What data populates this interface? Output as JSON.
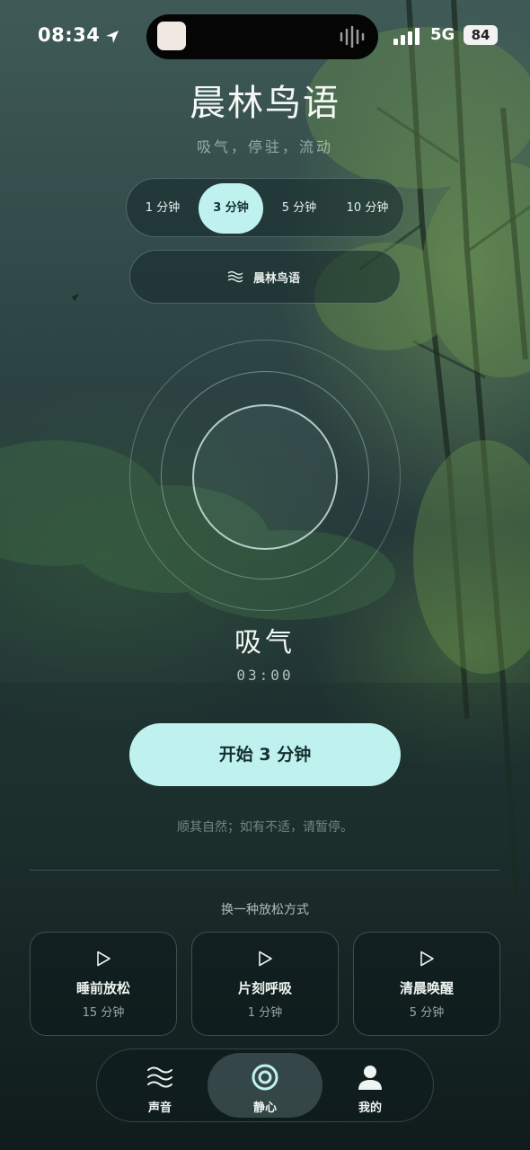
{
  "status_bar": {
    "time": "08:34",
    "network": "5G",
    "battery": "84"
  },
  "header": {
    "title": "晨林鸟语",
    "subtitle": "吸气，停驻，流动"
  },
  "durations": [
    {
      "label": "1 分钟",
      "active": false
    },
    {
      "label": "3 分钟",
      "active": true
    },
    {
      "label": "5 分钟",
      "active": false
    },
    {
      "label": "10 分钟",
      "active": false
    }
  ],
  "sound": {
    "label": "晨林鸟语",
    "icon": "waves-icon"
  },
  "breathing": {
    "phase": "吸气",
    "timer": "03:00"
  },
  "start_button": {
    "label": "开始 3 分钟"
  },
  "notice": "顺其自然；如有不适，请暂停。",
  "alternatives": {
    "title": "换一种放松方式",
    "items": [
      {
        "name": "睡前放松",
        "duration": "15 分钟",
        "icon": "play-icon"
      },
      {
        "name": "片刻呼吸",
        "duration": "1 分钟",
        "icon": "play-icon"
      },
      {
        "name": "清晨唤醒",
        "duration": "5 分钟",
        "icon": "play-icon"
      }
    ]
  },
  "tabbar": {
    "items": [
      {
        "label": "声音",
        "icon": "waves-icon",
        "active": false
      },
      {
        "label": "静心",
        "icon": "target-icon",
        "active": true
      },
      {
        "label": "我的",
        "icon": "user-icon",
        "active": false
      }
    ]
  },
  "colors": {
    "accent": "#bff2ef",
    "accent_text": "#14302f"
  }
}
